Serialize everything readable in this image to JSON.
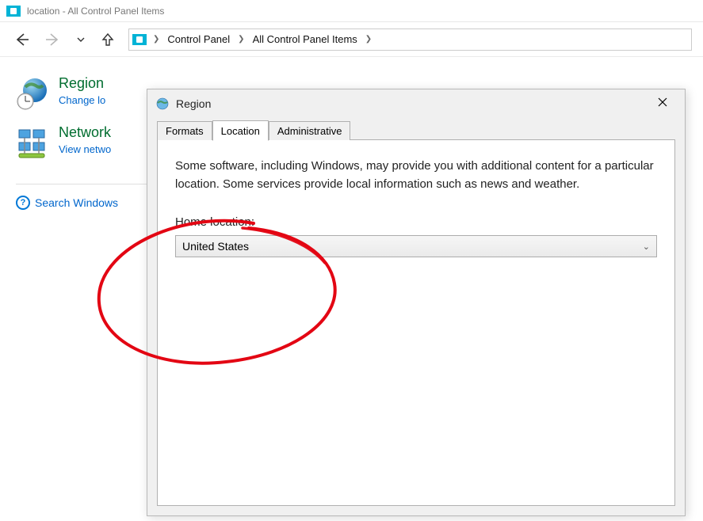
{
  "window": {
    "title": "location - All Control Panel Items"
  },
  "breadcrumb": {
    "root": "Control Panel",
    "path": "All Control Panel Items"
  },
  "controlPanelItems": [
    {
      "title": "Region",
      "link": "Change lo"
    },
    {
      "title": "Network",
      "link": "View netwo"
    }
  ],
  "search": {
    "label": "Search Windows"
  },
  "dialog": {
    "title": "Region",
    "tabs": [
      "Formats",
      "Location",
      "Administrative"
    ],
    "activeTab": "Location",
    "infoText": "Some software, including Windows, may provide you with additional content for a particular location. Some services provide local information such as news and weather.",
    "homeLocationLabel": "Home location:",
    "homeLocationValue": "United States"
  }
}
